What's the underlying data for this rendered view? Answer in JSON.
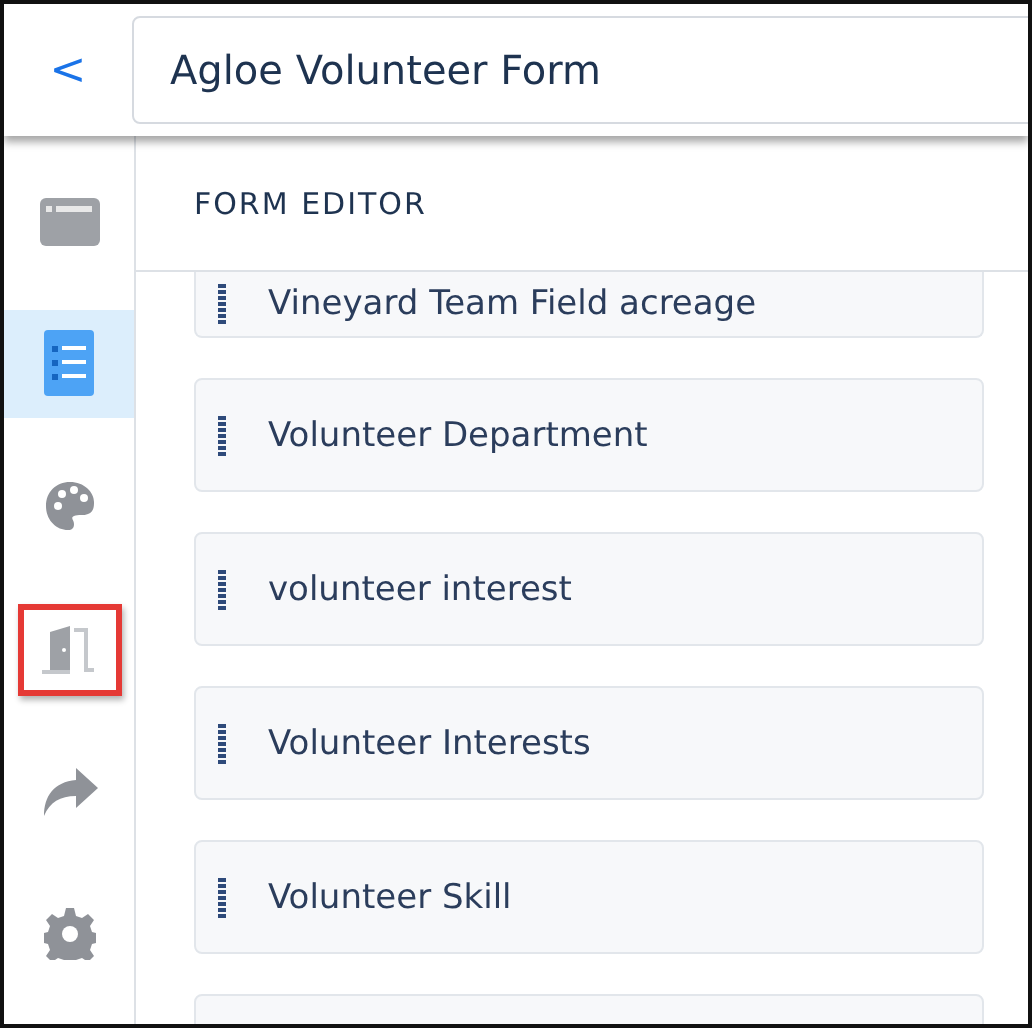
{
  "header": {
    "back": "<",
    "title": "Agloe Volunteer Form"
  },
  "sidebar": {
    "items": [
      {
        "kind": "card",
        "selected": false,
        "highlighted": false
      },
      {
        "kind": "list",
        "selected": true,
        "highlighted": false
      },
      {
        "kind": "palette",
        "selected": false,
        "highlighted": false
      },
      {
        "kind": "door",
        "selected": false,
        "highlighted": true
      },
      {
        "kind": "share",
        "selected": false,
        "highlighted": false
      },
      {
        "kind": "gear",
        "selected": false,
        "highlighted": false
      }
    ]
  },
  "editor": {
    "heading": "FORM EDITOR",
    "fields": [
      {
        "label": "Vineyard Team Field acreage"
      },
      {
        "label": "Volunteer Department"
      },
      {
        "label": "volunteer interest"
      },
      {
        "label": "Volunteer Interests"
      },
      {
        "label": "Volunteer Skill"
      }
    ]
  }
}
